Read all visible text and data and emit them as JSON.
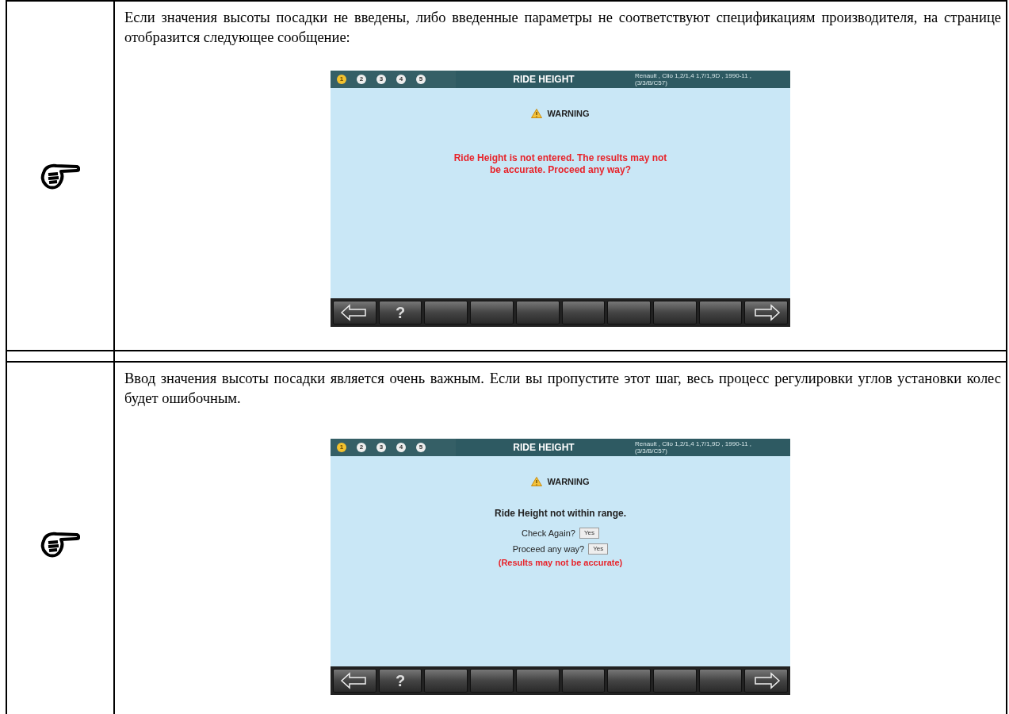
{
  "sections": [
    {
      "text": "Если значения высоты посадки не введены, либо введенные параметры не соответствуют спецификациям производителя, на странице отобразится следующее сообщение:",
      "screen": {
        "steps": [
          {
            "label": "1",
            "selected": true
          },
          {
            "label": "2",
            "selected": false
          },
          {
            "label": "3",
            "selected": false
          },
          {
            "label": "4",
            "selected": false
          },
          {
            "label": "5",
            "selected": false
          }
        ],
        "title": "RIDE HEIGHT",
        "vehicle": [
          "Renault , Clio 1,2/1,4 1,7/1,9D , 1990-11 ,",
          "(3/3/B/C57)"
        ],
        "warning_title": "WARNING",
        "body": [
          {
            "kind": "red_text",
            "text": "Ride Height is not entered. The results may not be accurate. Proceed any way?"
          }
        ],
        "toolbar": [
          {
            "kind": "back"
          },
          {
            "kind": "help",
            "label": "?"
          },
          {
            "kind": "blank"
          },
          {
            "kind": "blank"
          },
          {
            "kind": "blank"
          },
          {
            "kind": "blank"
          },
          {
            "kind": "blank"
          },
          {
            "kind": "blank"
          },
          {
            "kind": "blank"
          },
          {
            "kind": "forward"
          }
        ]
      }
    },
    {
      "text": "Ввод значения высоты посадки является очень важным. Если вы пропустите этот шаг, весь процесс регулировки углов установки колес будет ошибочным.",
      "screen": {
        "steps": [
          {
            "label": "1",
            "selected": true
          },
          {
            "label": "2",
            "selected": false
          },
          {
            "label": "3",
            "selected": false
          },
          {
            "label": "4",
            "selected": false
          },
          {
            "label": "5",
            "selected": false
          }
        ],
        "title": "RIDE HEIGHT",
        "vehicle": [
          "Renault , Clio 1,2/1,4 1,7/1,9D , 1990-11 ,",
          "(3/3/B/C57)"
        ],
        "warning_title": "WARNING",
        "body": [
          {
            "kind": "bold_text",
            "text": "Ride Height not within range."
          },
          {
            "kind": "question",
            "text": "Check Again?",
            "button": "Yes"
          },
          {
            "kind": "question",
            "text": "Proceed any way?",
            "button": "Yes"
          },
          {
            "kind": "red_note",
            "text": "(Results may not be accurate)"
          }
        ],
        "toolbar": [
          {
            "kind": "back"
          },
          {
            "kind": "help",
            "label": "?"
          },
          {
            "kind": "blank"
          },
          {
            "kind": "blank"
          },
          {
            "kind": "blank"
          },
          {
            "kind": "blank"
          },
          {
            "kind": "blank"
          },
          {
            "kind": "blank"
          },
          {
            "kind": "blank"
          },
          {
            "kind": "forward"
          }
        ]
      }
    }
  ]
}
